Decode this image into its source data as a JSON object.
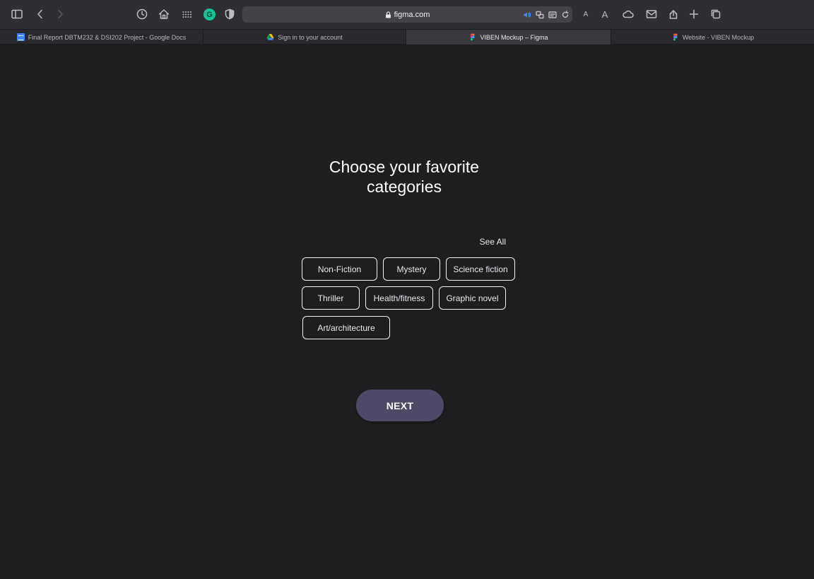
{
  "browser": {
    "address": "figma.com",
    "toolbar_icons": [
      "sidebar-icon",
      "back-icon",
      "forward-icon",
      "history-icon",
      "home-icon",
      "grid-icon",
      "grammarly-icon",
      "shield-icon",
      "audio-icon",
      "translate-icon",
      "reader-icon",
      "reload-icon",
      "font-small-icon",
      "font-large-icon",
      "cloud-icon",
      "mail-icon",
      "share-icon",
      "new-tab-icon",
      "tabs-overview-icon"
    ],
    "font_small": "A",
    "font_large": "A",
    "grammarly_letter": "G"
  },
  "tabs": [
    {
      "label": "Final Report DBTM232 & DSI202 Project - Google Docs",
      "favicon": "google-docs-icon",
      "active": false
    },
    {
      "label": "Sign in to your account",
      "favicon": "google-drive-icon",
      "active": false
    },
    {
      "label": "VIBEN Mockup – Figma",
      "favicon": "figma-icon",
      "active": true
    },
    {
      "label": "Website - VIBEN Mockup",
      "favicon": "figma-icon",
      "active": false
    }
  ],
  "main": {
    "title_line1": "Choose your favorite",
    "title_line2": "categories",
    "see_all": "See All",
    "categories": [
      "Non-Fiction",
      "Mystery",
      "Science fiction",
      "Thriller",
      "Health/fitness",
      "Graphic novel",
      "Art/architecture"
    ],
    "next_label": "NEXT"
  },
  "colors": {
    "background": "#1e1e20",
    "toolbar": "#2f2e33",
    "next_button": "#4d4a68",
    "chip_border": "#f2f2f2"
  }
}
